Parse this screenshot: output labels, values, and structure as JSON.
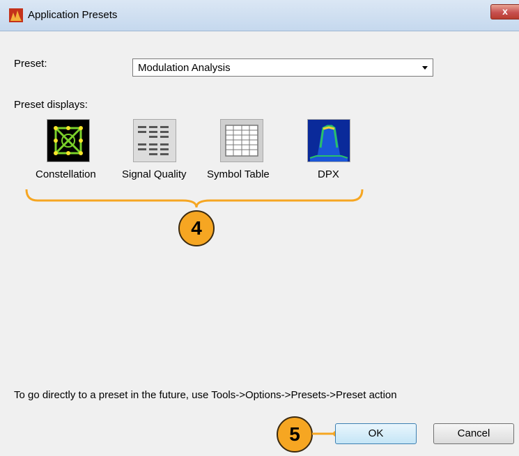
{
  "window": {
    "title": "Application Presets",
    "close_glyph": "x"
  },
  "preset": {
    "label": "Preset:",
    "selected": "Modulation Analysis"
  },
  "displays": {
    "label": "Preset displays:",
    "items": [
      {
        "label": "Constellation",
        "icon": "constellation-icon"
      },
      {
        "label": "Signal Quality",
        "icon": "signal-quality-icon"
      },
      {
        "label": "Symbol Table",
        "icon": "symbol-table-icon"
      },
      {
        "label": "DPX",
        "icon": "dpx-icon"
      }
    ]
  },
  "callouts": {
    "displays": "4",
    "ok": "5"
  },
  "colors": {
    "callout": "#f6a622",
    "brace": "#f6a622"
  },
  "hint": "To go directly to a preset in the future, use Tools->Options->Presets->Preset action",
  "buttons": {
    "ok": "OK",
    "cancel": "Cancel"
  }
}
